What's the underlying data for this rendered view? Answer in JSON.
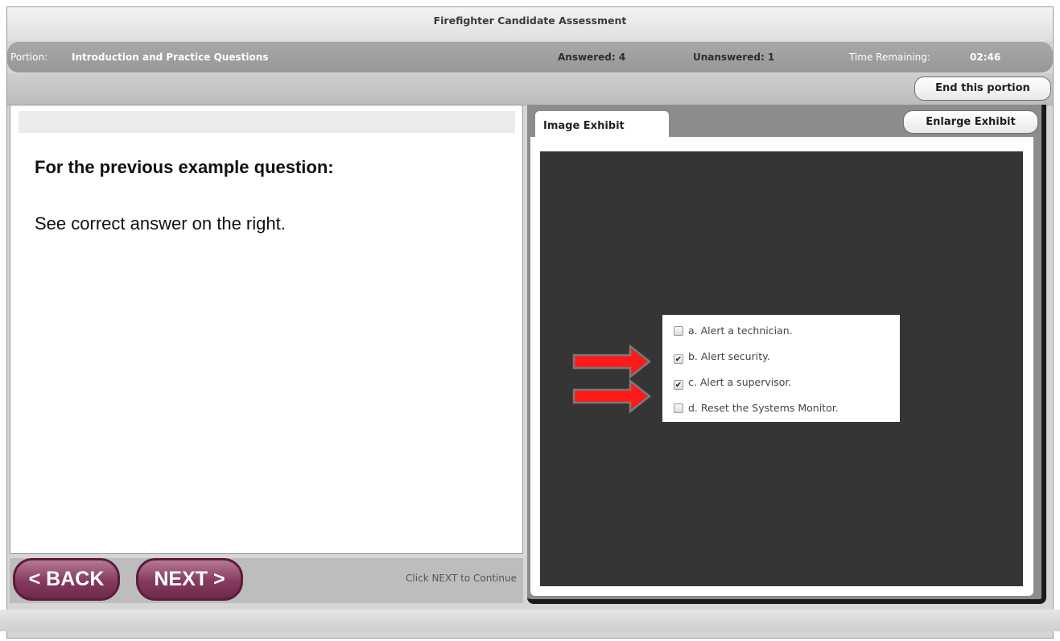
{
  "window": {
    "title": "Firefighter Candidate Assessment"
  },
  "status": {
    "portion_label": "Portion:",
    "portion_value": "Introduction and Practice Questions",
    "answered": "Answered: 4",
    "unanswered": "Unanswered: 1",
    "time_label": "Time Remaining:",
    "time_value": "02:46"
  },
  "toolbar": {
    "end_portion_label": "End this portion"
  },
  "question": {
    "heading": "For the previous example question:",
    "text": "See correct answer on the right."
  },
  "nav": {
    "back_label": "< BACK",
    "next_label": "NEXT >",
    "hint": "Click NEXT to Continue"
  },
  "exhibit": {
    "tab_label": "Image Exhibit",
    "enlarge_label": "Enlarge Exhibit",
    "options": [
      {
        "label": "a. Alert a technician.",
        "checked": false
      },
      {
        "label": "b. Alert security.",
        "checked": true
      },
      {
        "label": "c. Alert a supervisor.",
        "checked": true
      },
      {
        "label": "d. Reset the Systems Monitor.",
        "checked": false
      }
    ],
    "arrow_color": "#ff1a1a",
    "arrow_outline": "#7a7a7a"
  },
  "colors": {
    "nav_button": "#843a5e",
    "exhibit_background": "#353535"
  },
  "icons": {
    "arrow": "right-arrow-icon",
    "checkbox": "checkbox-icon"
  }
}
